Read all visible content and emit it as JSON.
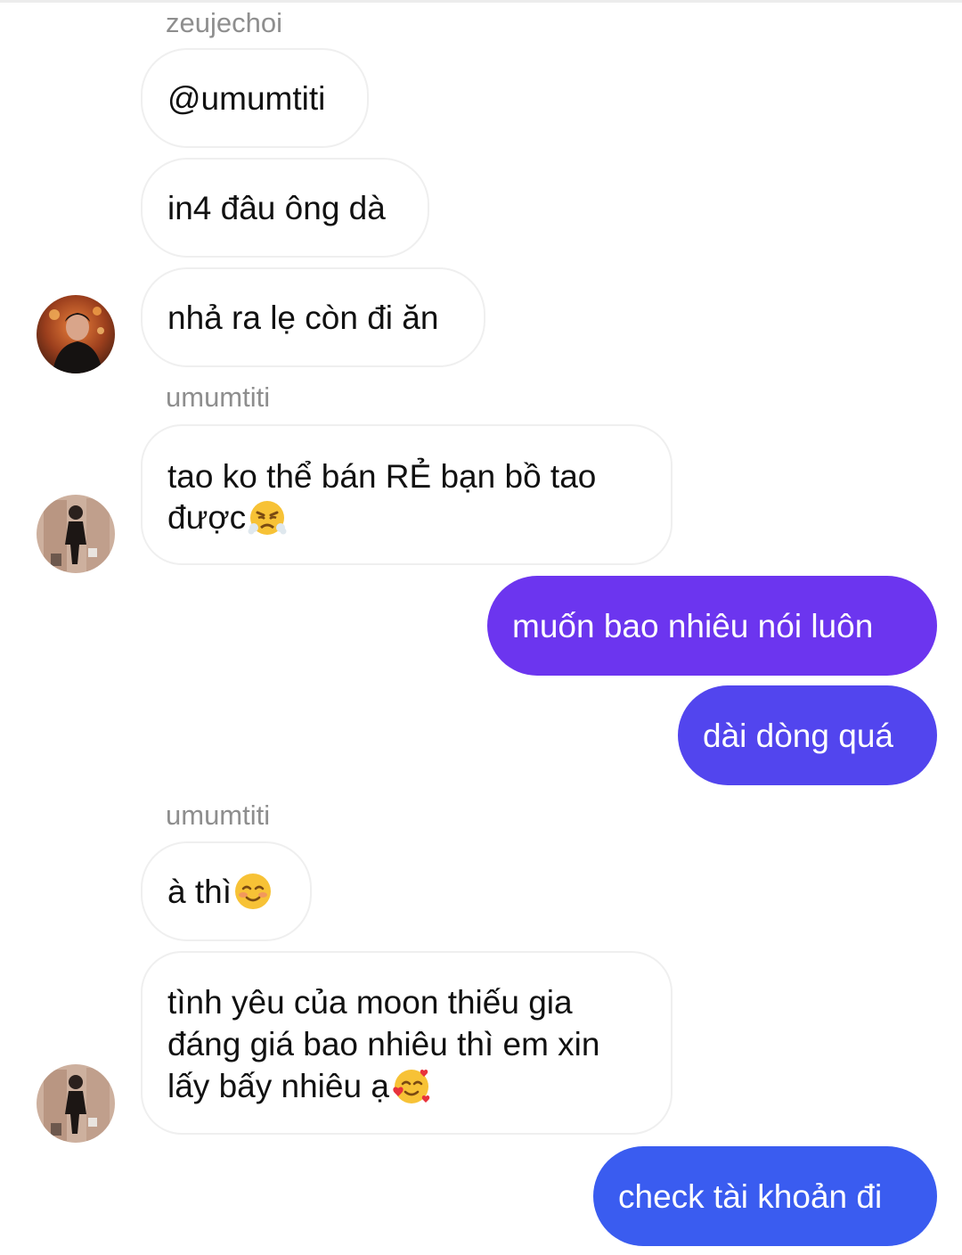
{
  "messages": {
    "m0": {
      "sender": "zeujechoi",
      "text": "@umumtiti"
    },
    "m1": {
      "text": "in4 đâu ông dà"
    },
    "m2": {
      "text": "nhả ra lẹ còn đi ăn"
    },
    "m3": {
      "sender": "umumtiti",
      "text": "tao ko thể bán RẺ bạn bồ tao",
      "text2": "được"
    },
    "m4": {
      "text": "muốn bao nhiêu nói luôn"
    },
    "m5": {
      "text": "dài dòng quá"
    },
    "m6": {
      "sender": "umumtiti",
      "text": "à thì "
    },
    "m7": {
      "text": "tình yêu của moon thiếu gia",
      "text2": "đáng giá bao nhiêu thì em xin",
      "text3": "lấy bấy nhiêu ạ"
    },
    "m8": {
      "text": "check tài khoản đi"
    }
  },
  "colors": {
    "outgoing_purple": "#6c35ef",
    "outgoing_blue": "#3a5cf0",
    "incoming_border": "#efefef",
    "sender_text": "#8e8e8e"
  },
  "icons": [
    "avatar-zeujechoi",
    "avatar-umumtiti",
    "steam-nose-emoji",
    "smiling-blush-emoji",
    "smiling-hearts-emoji"
  ]
}
